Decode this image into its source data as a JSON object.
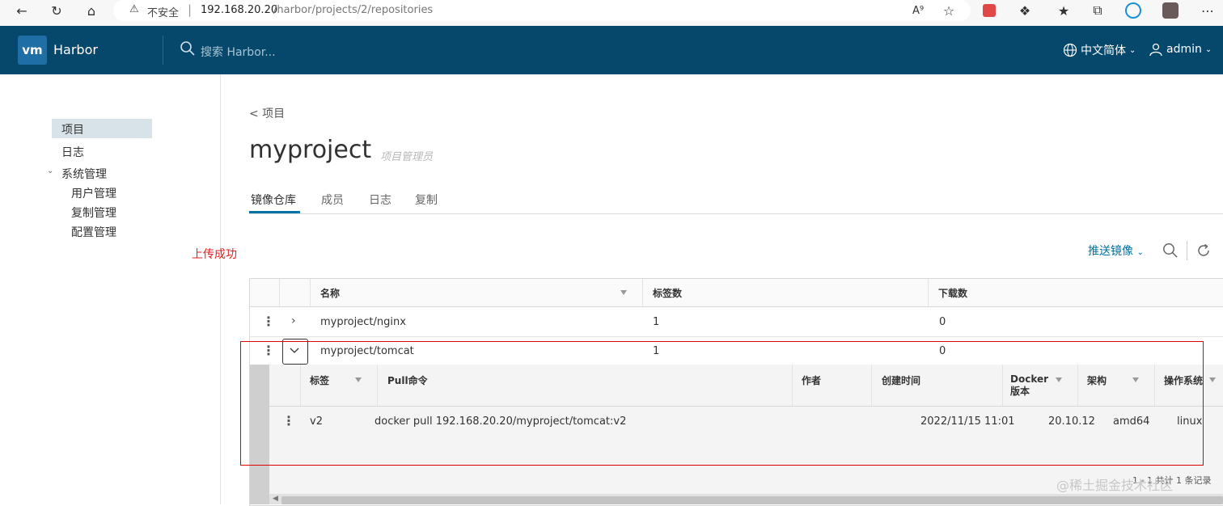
{
  "browser": {
    "insecure_label": "不安全",
    "separator": "|",
    "url_host": "192.168.20.20",
    "url_path": "/harbor/projects/2/repositories"
  },
  "header": {
    "logo": "vm",
    "brand": "Harbor",
    "search_placeholder": "搜索 Harbor...",
    "language": "中文简体",
    "user": "admin"
  },
  "sidebar": {
    "items": [
      {
        "label": "项目"
      },
      {
        "label": "日志"
      },
      {
        "label": "系统管理"
      }
    ],
    "sub_items": [
      {
        "label": "用户管理"
      },
      {
        "label": "复制管理"
      },
      {
        "label": "配置管理"
      }
    ]
  },
  "annotation": "上传成功",
  "page": {
    "breadcrumb": "< 项目",
    "title": "myproject",
    "role": "项目管理员",
    "tabs": [
      {
        "label": "镜像仓库"
      },
      {
        "label": "成员"
      },
      {
        "label": "日志"
      },
      {
        "label": "复制"
      }
    ],
    "push_button": "推送镜像"
  },
  "repo_table": {
    "headers": [
      "名称",
      "标签数",
      "下载数"
    ],
    "rows": [
      {
        "name": "myproject/nginx",
        "tags": "1",
        "pulls": "0"
      },
      {
        "name": "myproject/tomcat",
        "tags": "1",
        "pulls": "0"
      }
    ]
  },
  "tag_table": {
    "headers": [
      "标签",
      "Pull命令",
      "作者",
      "创建时间",
      "Docker\n版本",
      "架构",
      "操作系统"
    ],
    "docker_line1": "Docker",
    "docker_line2": "版本",
    "rows": [
      {
        "tag": "v2",
        "pull": "docker pull 192.168.20.20/myproject/tomcat:v2",
        "author": "",
        "created": "2022/11/15 11:01",
        "docker": "20.10.12",
        "arch": "amd64",
        "os": "linux"
      }
    ],
    "footer": "1 - 1 共计 1 条记录"
  },
  "watermark": "@稀土掘金技术社区"
}
